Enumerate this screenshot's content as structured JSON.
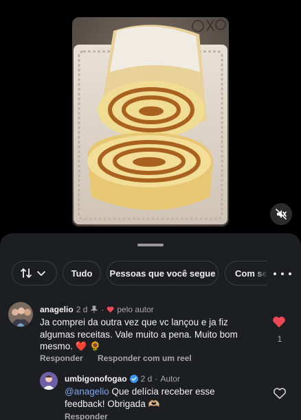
{
  "video": {
    "icon": "mute-icon"
  },
  "filters": {
    "sort_icon": "sort-arrows-icon",
    "chevron_icon": "chevron-down-icon",
    "tudo": "Tudo",
    "pessoas": "Pessoas que você segue",
    "com": "Com se",
    "more_icon": "more-horizontal-icon"
  },
  "comments": [
    {
      "username": "anagelio",
      "time": "2 d",
      "pinned_icon": "pin-icon",
      "author_label": "pelo autor",
      "text": "Ja comprei da outra vez que vc lançou e ja fiz algumas receitas. Vale muito a pena. Muito bom mesmo. ❤️ 🌻",
      "likes": "1",
      "reply_label": "Responder",
      "reel_reply_label": "Responder com um reel",
      "liked": true
    },
    {
      "username": "umbigonofogao",
      "verified": true,
      "time": "2 d",
      "author_tag": "Autor",
      "mention": "@anagelio",
      "text": "Que delícia receber esse feedback! Obrigada 🫶🏼",
      "reply_label": "Responder",
      "liked": false
    }
  ],
  "colors": {
    "like_red": "#ed4956",
    "mention_blue": "#7fa8ee",
    "verified_blue": "#3897f0",
    "sheet_bg": "#1c1e21"
  }
}
